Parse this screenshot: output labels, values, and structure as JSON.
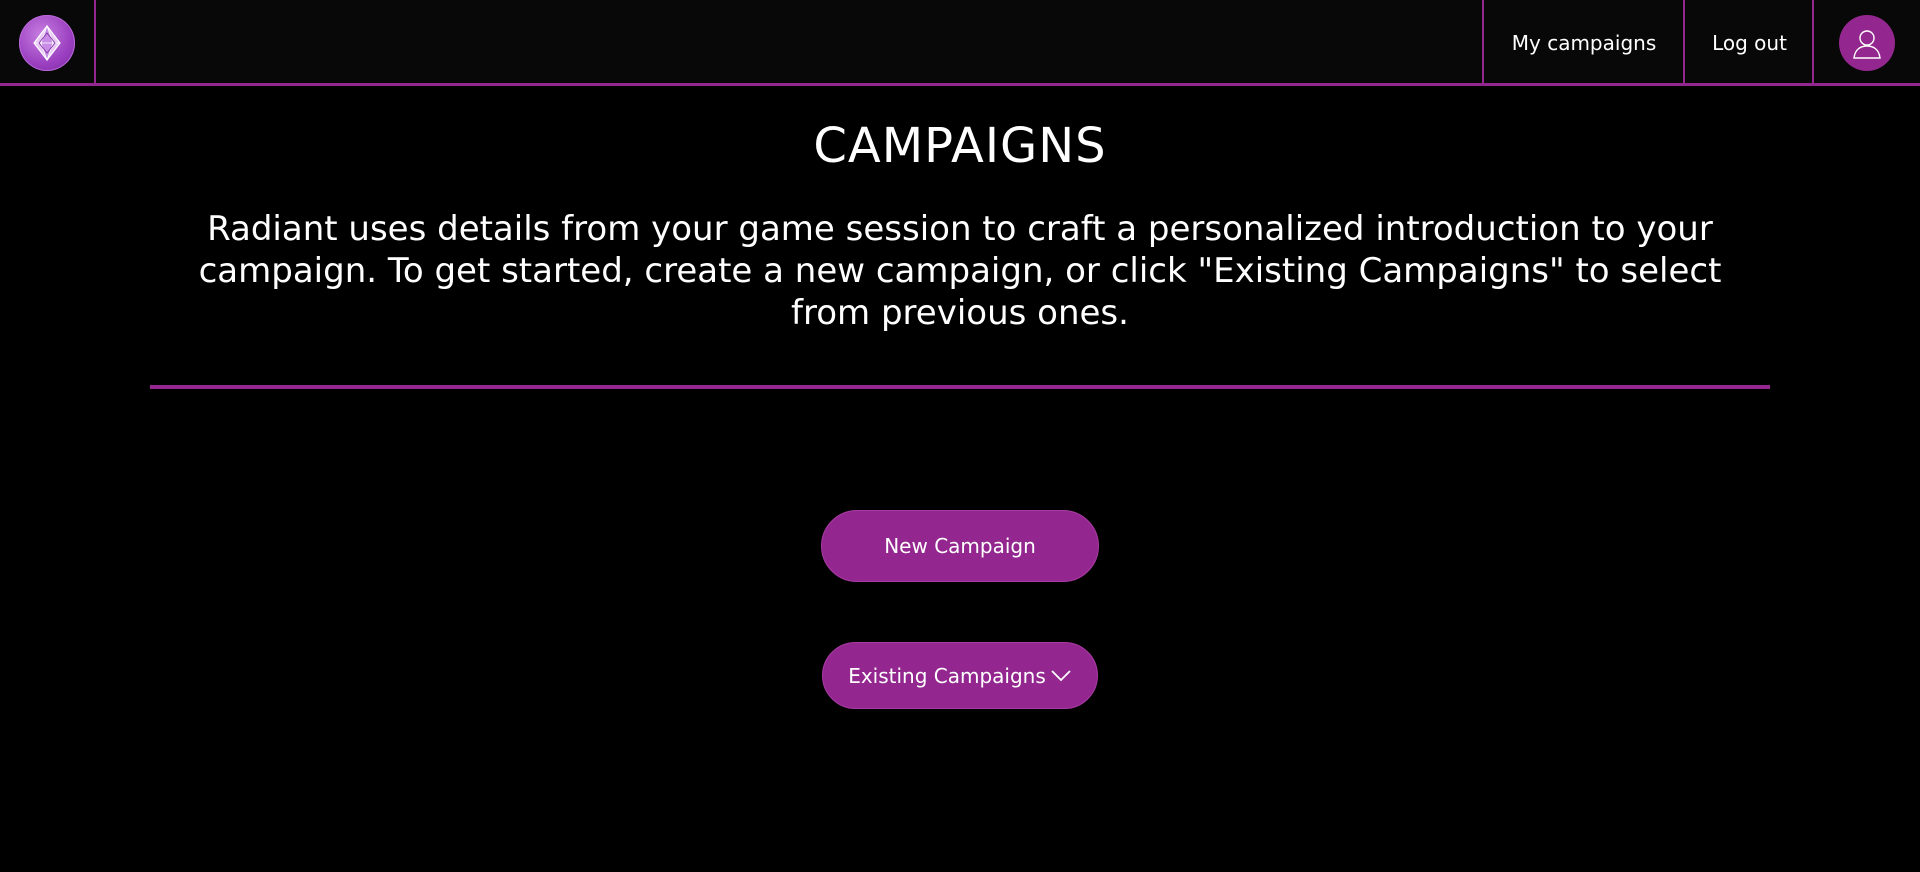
{
  "header": {
    "logo_name": "radiant-crystal-logo",
    "nav": [
      {
        "label": "My campaigns"
      },
      {
        "label": "Log out"
      }
    ],
    "avatar_icon": "user-icon"
  },
  "main": {
    "title": "CAMPAIGNS",
    "intro": "Radiant uses details from your game session to craft a personalized introduction to your campaign. To get started, create a new campaign, or click \"Existing Campaigns\" to select from previous ones.",
    "new_campaign_label": "New Campaign",
    "existing_campaigns_label": "Existing Campaigns",
    "existing_campaigns_icon": "chevron-down-icon"
  },
  "colors": {
    "accent": "#93278f",
    "background": "#000000",
    "topbar": "#080808",
    "text": "#ffffff"
  }
}
